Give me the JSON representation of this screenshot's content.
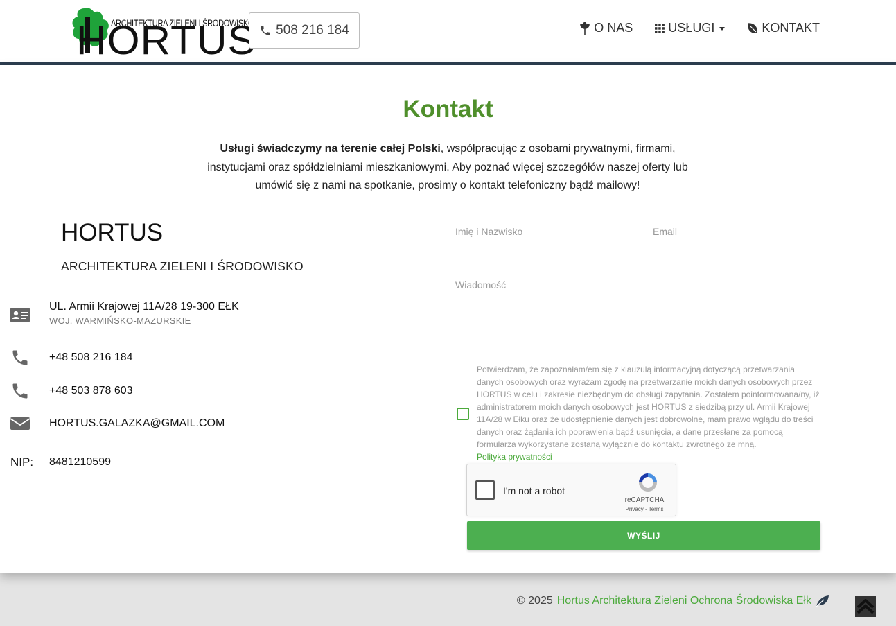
{
  "header": {
    "logo_tagline": "ARCHITEKTURA ZIELENI I ŚRODOWISKO",
    "logo_wordmark": "HORTUS",
    "phone": "508 216 184",
    "nav": [
      {
        "label": "O NAS",
        "icon": "leaf-sprig-icon"
      },
      {
        "label": "USŁUGI",
        "icon": "grid-icon"
      },
      {
        "label": "KONTAKT",
        "icon": "leaf-icon"
      }
    ]
  },
  "main": {
    "title": "Kontakt",
    "intro_strong": "Usługi świadczymy na terenie całej Polski",
    "intro_rest": ", współpracując z osobami prywatnymi, firmami, instytucjami oraz spółdzielniami mieszkaniowymi. Aby poznać więcej szczegółów naszej oferty lub umówić się z nami na spotkanie, prosimy o kontakt telefoniczny bądź mailowy!"
  },
  "contact": {
    "name": "HORTUS",
    "subtitle": "ARCHITEKTURA ZIELENI I ŚRODOWISKO",
    "address": "UL. Armii Krajowej 11A/28 19-300 EŁK",
    "region": "WOJ. WARMIŃSKO-MAZURSKIE",
    "phone1": "+48 508 216 184",
    "phone2": "+48 503 878 603",
    "email": "HORTUS.GALAZKA@GMAIL.COM",
    "nip_label": "NIP:",
    "nip": "8481210599"
  },
  "form": {
    "name_placeholder": "Imię i Nazwisko",
    "email_placeholder": "Email",
    "message_placeholder": "Wiadomość",
    "consent": "Potwierdzam, że zapoznałam/em się z klauzulą informacyjną dotyczącą przetwarzania danych osobowych oraz wyrażam zgodę na przetwarzanie moich danych osobowych przez HORTUS w celu i zakresie niezbędnym do obsługi zapytania. Zostałem poinformowana/ny, iż administratorem moich danych osobowych jest HORTUS z siedzibą przy ul. Armii Krajowej 11A/28 w Ełku oraz że udostępnienie danych jest dobrowolne, mam prawo wglądu do treści danych oraz żądania ich poprawienia bądź usunięcia, a dane przesłane za pomocą formularza wykorzystane zostaną wyłącznie do kontaktu zwrotnego ze mną.",
    "policy_link": "Polityka prywatności",
    "captcha_label": "I'm not a robot",
    "captcha_brand": "reCAPTCHA",
    "captcha_links": "Privacy - Terms",
    "submit": "WYŚLIJ"
  },
  "footer": {
    "copyright": "© 2025",
    "link": "Hortus Architektura Zieleni Ochrona Środowiska Ełk"
  },
  "colors": {
    "accent_green": "#4f8f2b",
    "button_green": "#4caf50",
    "header_border": "#2d3e50"
  }
}
